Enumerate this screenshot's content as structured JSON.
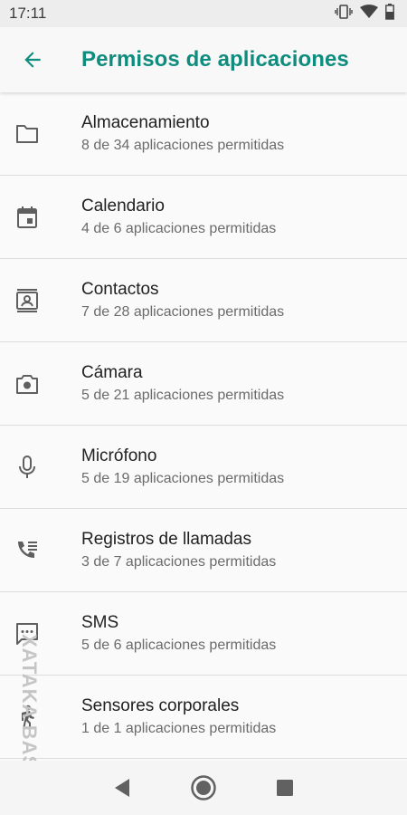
{
  "status_bar": {
    "time": "17:11",
    "icons": [
      "vibrate-icon",
      "wifi-icon",
      "battery-icon"
    ]
  },
  "app_bar": {
    "title": "Permisos de aplicaciones",
    "back_icon": "arrow-back-icon"
  },
  "permissions": [
    {
      "label": "Almacenamiento",
      "summary": "8 de 34 aplicaciones permitidas",
      "icon": "folder-icon"
    },
    {
      "label": "Calendario",
      "summary": "4 de 6 aplicaciones permitidas",
      "icon": "calendar-icon"
    },
    {
      "label": "Contactos",
      "summary": "7 de 28 aplicaciones permitidas",
      "icon": "contacts-icon"
    },
    {
      "label": "Cámara",
      "summary": "5 de 21 aplicaciones permitidas",
      "icon": "camera-icon"
    },
    {
      "label": "Micrófono",
      "summary": "5 de 19 aplicaciones permitidas",
      "icon": "microphone-icon"
    },
    {
      "label": "Registros de llamadas",
      "summary": "3 de 7 aplicaciones permitidas",
      "icon": "call-log-icon"
    },
    {
      "label": "SMS",
      "summary": "5 de 6 aplicaciones permitidas",
      "icon": "sms-icon"
    },
    {
      "label": "Sensores corporales",
      "summary": "1 de 1 aplicaciones permitidas",
      "icon": "body-sensor-icon"
    }
  ],
  "nav_bar": {
    "buttons": [
      "back-triangle-icon",
      "home-circle-icon",
      "recents-square-icon"
    ]
  },
  "watermark": {
    "text": "XATAKA BASICS"
  },
  "colors": {
    "accent": "#0e8c7d",
    "icon": "#5f5f5f"
  }
}
